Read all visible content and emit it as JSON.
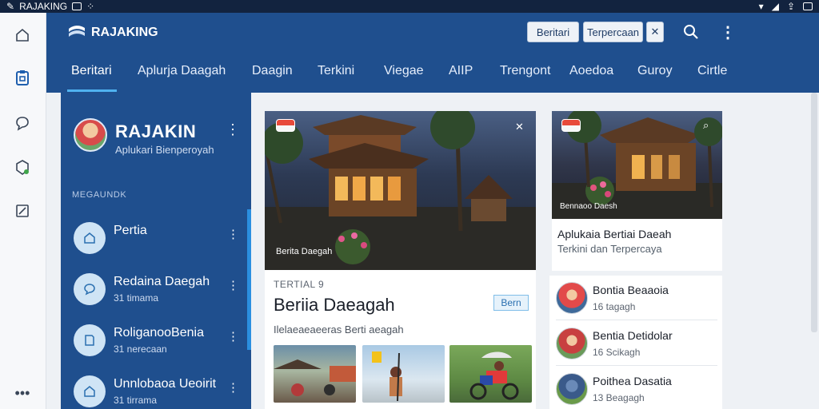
{
  "status_bar": {
    "app_name": "RAJAKING"
  },
  "brand": {
    "name": "RAJAKING"
  },
  "top_buttons": {
    "berita": "Beritari",
    "terpercaya": "Terpercaan"
  },
  "tabs": [
    "Beritari",
    "Aplurja Daagah",
    "Daagin",
    "Terkini",
    "Viegae",
    "AIIP",
    "Trengont",
    "Aoedoa",
    "Guroy",
    "Cirtle"
  ],
  "sidebar": {
    "title": "RAJAKIN",
    "subtitle": "Aplukari Bienperoyah",
    "section_label": "MEGAUNDK",
    "items": [
      {
        "title": "Pertia",
        "meta": ""
      },
      {
        "title": "Redaina Daegah",
        "meta": "31 timama"
      },
      {
        "title": "RoliganooBenia",
        "meta": "31 nerecaan"
      },
      {
        "title": "Unnlobaoa Ueoirit",
        "meta": "31 tirrama"
      }
    ]
  },
  "main_card": {
    "hero_caption": "Berita Daegah",
    "tag": "TERTIAL 9",
    "title": "Beriia Daeagah",
    "badge": "Bern",
    "subtitle": "Ilelaeaeaeeras Berti aeagah"
  },
  "right_card": {
    "hero_caption": "Bennaoo Daesh",
    "title": "Aplukaia Bertiai Daeah",
    "subtitle": "Terkini dan Terpercaya"
  },
  "right_list": [
    {
      "title": "Bontia Beaaoia",
      "meta": "16 tagagh"
    },
    {
      "title": "Bentia Detidolar",
      "meta": "16 Scikagh"
    },
    {
      "title": "Poithea Dasatia",
      "meta": "13 Beagagh"
    }
  ],
  "colors": {
    "primary": "#1f4f8e",
    "accent": "#4fb2f0",
    "status_bar": "#12233f"
  }
}
